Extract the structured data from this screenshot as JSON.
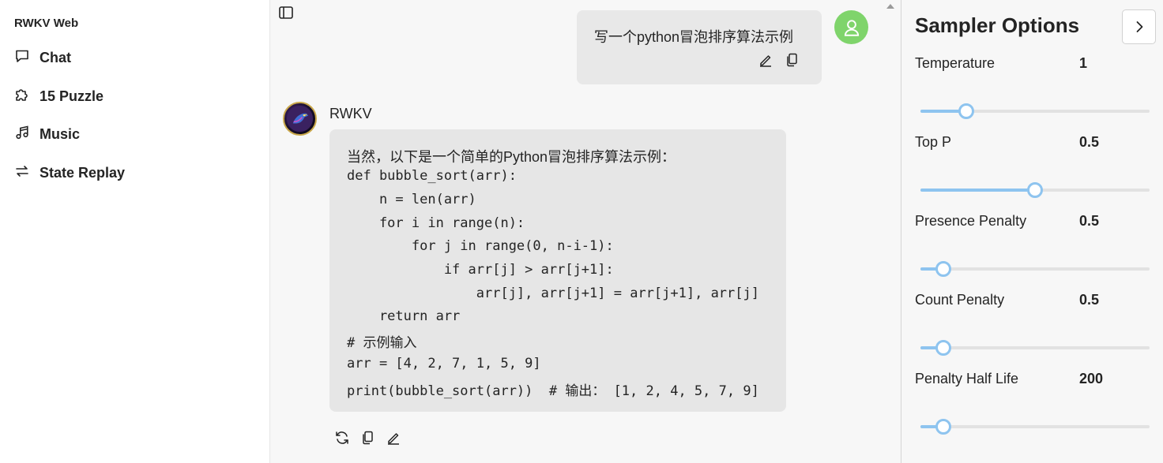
{
  "sidebar": {
    "brand": "RWKV Web",
    "items": [
      {
        "label": "Chat",
        "icon": "chat-icon"
      },
      {
        "label": "15 Puzzle",
        "icon": "puzzle-icon"
      },
      {
        "label": "Music",
        "icon": "music-note-icon"
      },
      {
        "label": "State Replay",
        "icon": "replay-arrows-icon"
      }
    ]
  },
  "chat": {
    "user_message": "写一个python冒泡排序算法示例",
    "bot_name": "RWKV",
    "bot_intro": "当然，以下是一个简单的Python冒泡排序算法示例：",
    "code_lines": [
      "def bubble_sort(arr):",
      "    n = len(arr)",
      "    for i in range(n):",
      "        for j in range(0, n-i-1):",
      "            if arr[j] > arr[j+1]:",
      "                arr[j], arr[j+1] = arr[j+1], arr[j]",
      "    return arr",
      "# 示例输入",
      "arr = [4, 2, 7, 1, 5, 9]",
      "print(bubble_sort(arr))  # 输出： [1, 2, 4, 5, 7, 9]"
    ],
    "user_avatar_color": "#7fd46b"
  },
  "sampler": {
    "title": "Sampler Options",
    "accent": "#8ec4ef",
    "options": [
      {
        "label": "Temperature",
        "value": "1",
        "level": 0.2
      },
      {
        "label": "Top P",
        "value": "0.5",
        "level": 0.5
      },
      {
        "label": "Presence Penalty",
        "value": "0.5",
        "level": 0.1
      },
      {
        "label": "Count Penalty",
        "value": "0.5",
        "level": 0.1
      },
      {
        "label": "Penalty Half Life",
        "value": "200",
        "level": 0.1
      }
    ]
  }
}
